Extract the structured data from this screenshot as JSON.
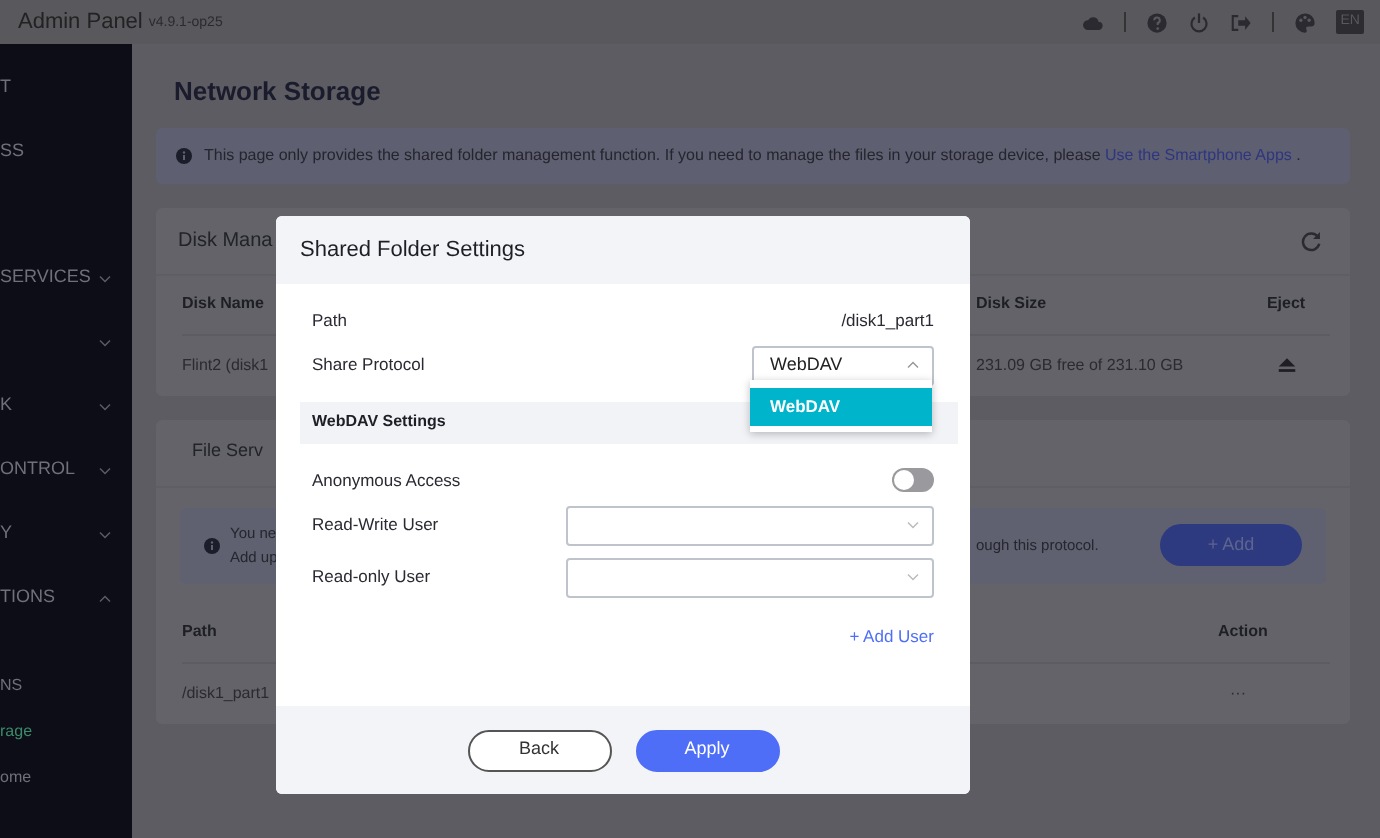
{
  "top_bar": {
    "title": "Admin Panel",
    "version": "v4.9.1-op25",
    "language": "EN"
  },
  "sidebar": {
    "items": [
      {
        "label": "T"
      },
      {
        "label": "SS"
      },
      {
        "label": "SERVICES",
        "expanded": false
      },
      {
        "expanded": false
      },
      {
        "label": "K",
        "expanded": false
      },
      {
        "label": "ONTROL",
        "expanded": false
      },
      {
        "label": "Y",
        "expanded": false
      },
      {
        "label": "TIONS",
        "expanded": true,
        "children": [
          {
            "label": "NS",
            "selected": false
          },
          {
            "label": "rage",
            "selected": true
          },
          {
            "label": "ome",
            "selected": false
          }
        ]
      }
    ]
  },
  "page": {
    "title": "Network Storage",
    "notice": {
      "text": "This page only provides the shared folder management function. If you need to manage the files in your storage device, please",
      "link": "Use the Smartphone Apps",
      "end": "."
    }
  },
  "disk_card": {
    "title": "Disk Mana",
    "columns": [
      "Disk Name",
      "Disk Size",
      "Eject"
    ],
    "rows": [
      {
        "name": "Flint2 (disk1",
        "size": "231.09 GB free of 231.10 GB"
      }
    ]
  },
  "file_card": {
    "title": "File Serv",
    "notice": {
      "lines": [
        "You ne",
        "Add up"
      ],
      "tail": "ough this protocol."
    },
    "add_button": "+ Add",
    "columns": [
      "Path",
      "Action"
    ],
    "rows": [
      {
        "path": "/disk1_part1",
        "action": "···"
      }
    ]
  },
  "dialog": {
    "title": "Shared Folder Settings",
    "path": {
      "label": "Path",
      "value": "/disk1_part1"
    },
    "protocol": {
      "label": "Share Protocol",
      "value": "WebDAV",
      "expanded": true,
      "options": [
        {
          "label": "WebDAV",
          "selected": true
        }
      ]
    },
    "section": "WebDAV Settings",
    "anonymous": {
      "label": "Anonymous Access",
      "on": false
    },
    "users": [
      {
        "label": "Read-Write User"
      },
      {
        "label": "Read-only User"
      }
    ],
    "add_user": "+ Add User",
    "buttons": [
      {
        "label": "Back",
        "kind": "secondary"
      },
      {
        "label": "Apply",
        "kind": "primary"
      }
    ]
  }
}
